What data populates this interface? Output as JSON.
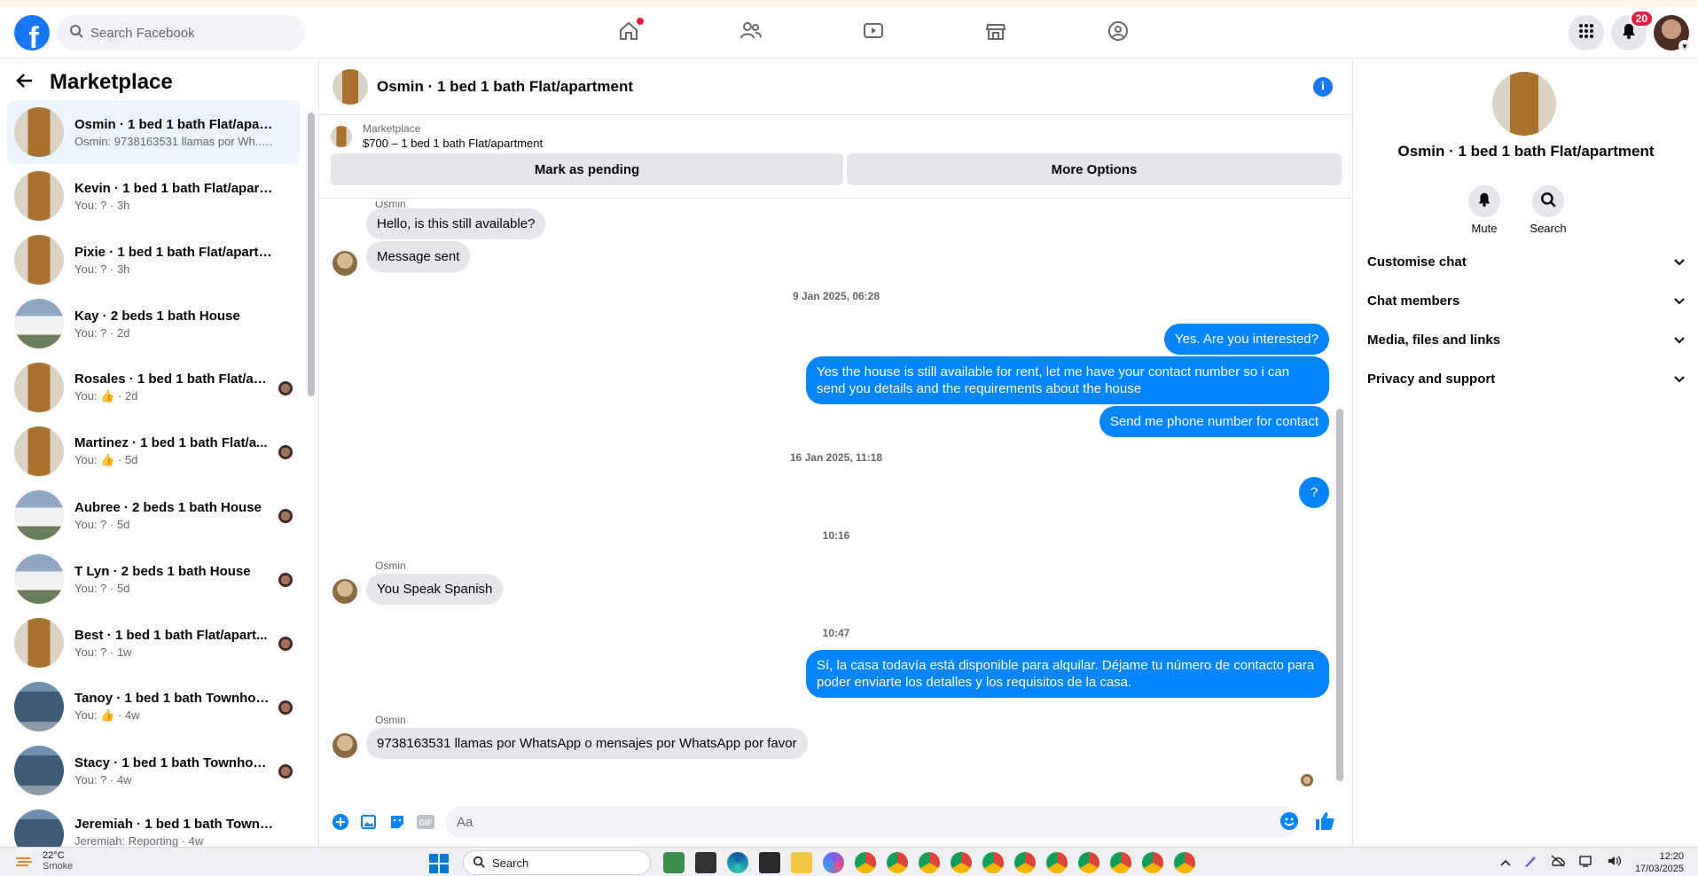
{
  "topbar": {
    "search_placeholder": "Search Facebook",
    "notification_count": "20",
    "colors": {
      "brand": "#1877f2",
      "badge": "#e41e3f"
    }
  },
  "sidebar": {
    "title": "Marketplace",
    "conversations": [
      {
        "name": "Osmin · 1 bed 1 bath Flat/apart...",
        "sub": "Osmin: 9738163531 llamas por Wh... · 1h",
        "thumb": "door",
        "active": true
      },
      {
        "name": "Kevin · 1 bed 1 bath Flat/apartm...",
        "sub": "You: ? · 3h",
        "thumb": "door"
      },
      {
        "name": "Pixie · 1 bed 1 bath Flat/apartment",
        "sub": "You: ? · 3h",
        "thumb": "door"
      },
      {
        "name": "Kay · 2 beds 1 bath House",
        "sub": "You: ? · 2d",
        "thumb": "house"
      },
      {
        "name": "Rosales · 1 bed 1 bath Flat/apa...",
        "sub": "You: 👍 · 2d",
        "thumb": "door",
        "seen": true
      },
      {
        "name": "Martinez · 1 bed 1 bath Flat/a...",
        "sub": "You: 👍 · 5d",
        "thumb": "door",
        "seen": true
      },
      {
        "name": "Aubree · 2 beds 1 bath House",
        "sub": "You: ? · 5d",
        "thumb": "house",
        "seen": true
      },
      {
        "name": "T Lyn · 2 beds 1 bath House",
        "sub": "You: ? · 5d",
        "thumb": "house",
        "seen": true
      },
      {
        "name": "Best · 1 bed 1 bath Flat/apart...",
        "sub": "You: ? · 1w",
        "thumb": "door",
        "seen": true
      },
      {
        "name": "Tanoy · 1 bed 1 bath Townhouse",
        "sub": "You: 👍 · 4w",
        "thumb": "town",
        "seen": true
      },
      {
        "name": "Stacy · 1 bed 1 bath Townhouse",
        "sub": "You: ? · 4w",
        "thumb": "town",
        "seen": true
      },
      {
        "name": "Jeremiah · 1 bed 1 bath Townhou...",
        "sub": "Jeremiah: Reporting · 4w",
        "thumb": "town"
      }
    ]
  },
  "chat": {
    "title": "Osmin · 1 bed 1 bath Flat/apartment",
    "listing": {
      "category": "Marketplace",
      "price_title": "$700 – 1 bed 1 bath Flat/apartment",
      "pending_label": "Mark as pending",
      "options_label": "More Options"
    },
    "messages": {
      "sender_top": "Osmin",
      "m1": "Hello, is this still available?",
      "m2": "Message sent",
      "stamp1": "9 Jan 2025, 06:28",
      "m3": "Yes. Are you interested?",
      "m4": "Yes the house is still available for rent, let me have your contact number so i can send you details and the requirements about the house",
      "m5": "Send me phone number for contact",
      "stamp2": "16 Jan 2025, 11:18",
      "m6": "?",
      "stamp3": "10:16",
      "sender2": "Osmin",
      "m7": "You Speak Spanish",
      "stamp4": "10:47",
      "m8": "Sí, la casa todavía está disponible para alquilar. Déjame tu número de contacto para poder enviarte los detalles y los requisitos de la casa.",
      "sender3": "Osmin",
      "m9": "9738163531 llamas por WhatsApp o mensajes por WhatsApp por favor"
    },
    "composer_placeholder": "Aa",
    "colors": {
      "outgoing": "#0084ff",
      "incoming": "#e4e6eb"
    }
  },
  "right_panel": {
    "name": "Osmin · 1 bed 1 bath Flat/apartment",
    "mute_label": "Mute",
    "search_label": "Search",
    "sections": [
      "Customise chat",
      "Chat members",
      "Media, files and links",
      "Privacy and support"
    ]
  },
  "taskbar": {
    "temperature": "22°C",
    "weather": "Smoke",
    "search_label": "Search",
    "time": "12:20",
    "date": "17/03/2025"
  }
}
